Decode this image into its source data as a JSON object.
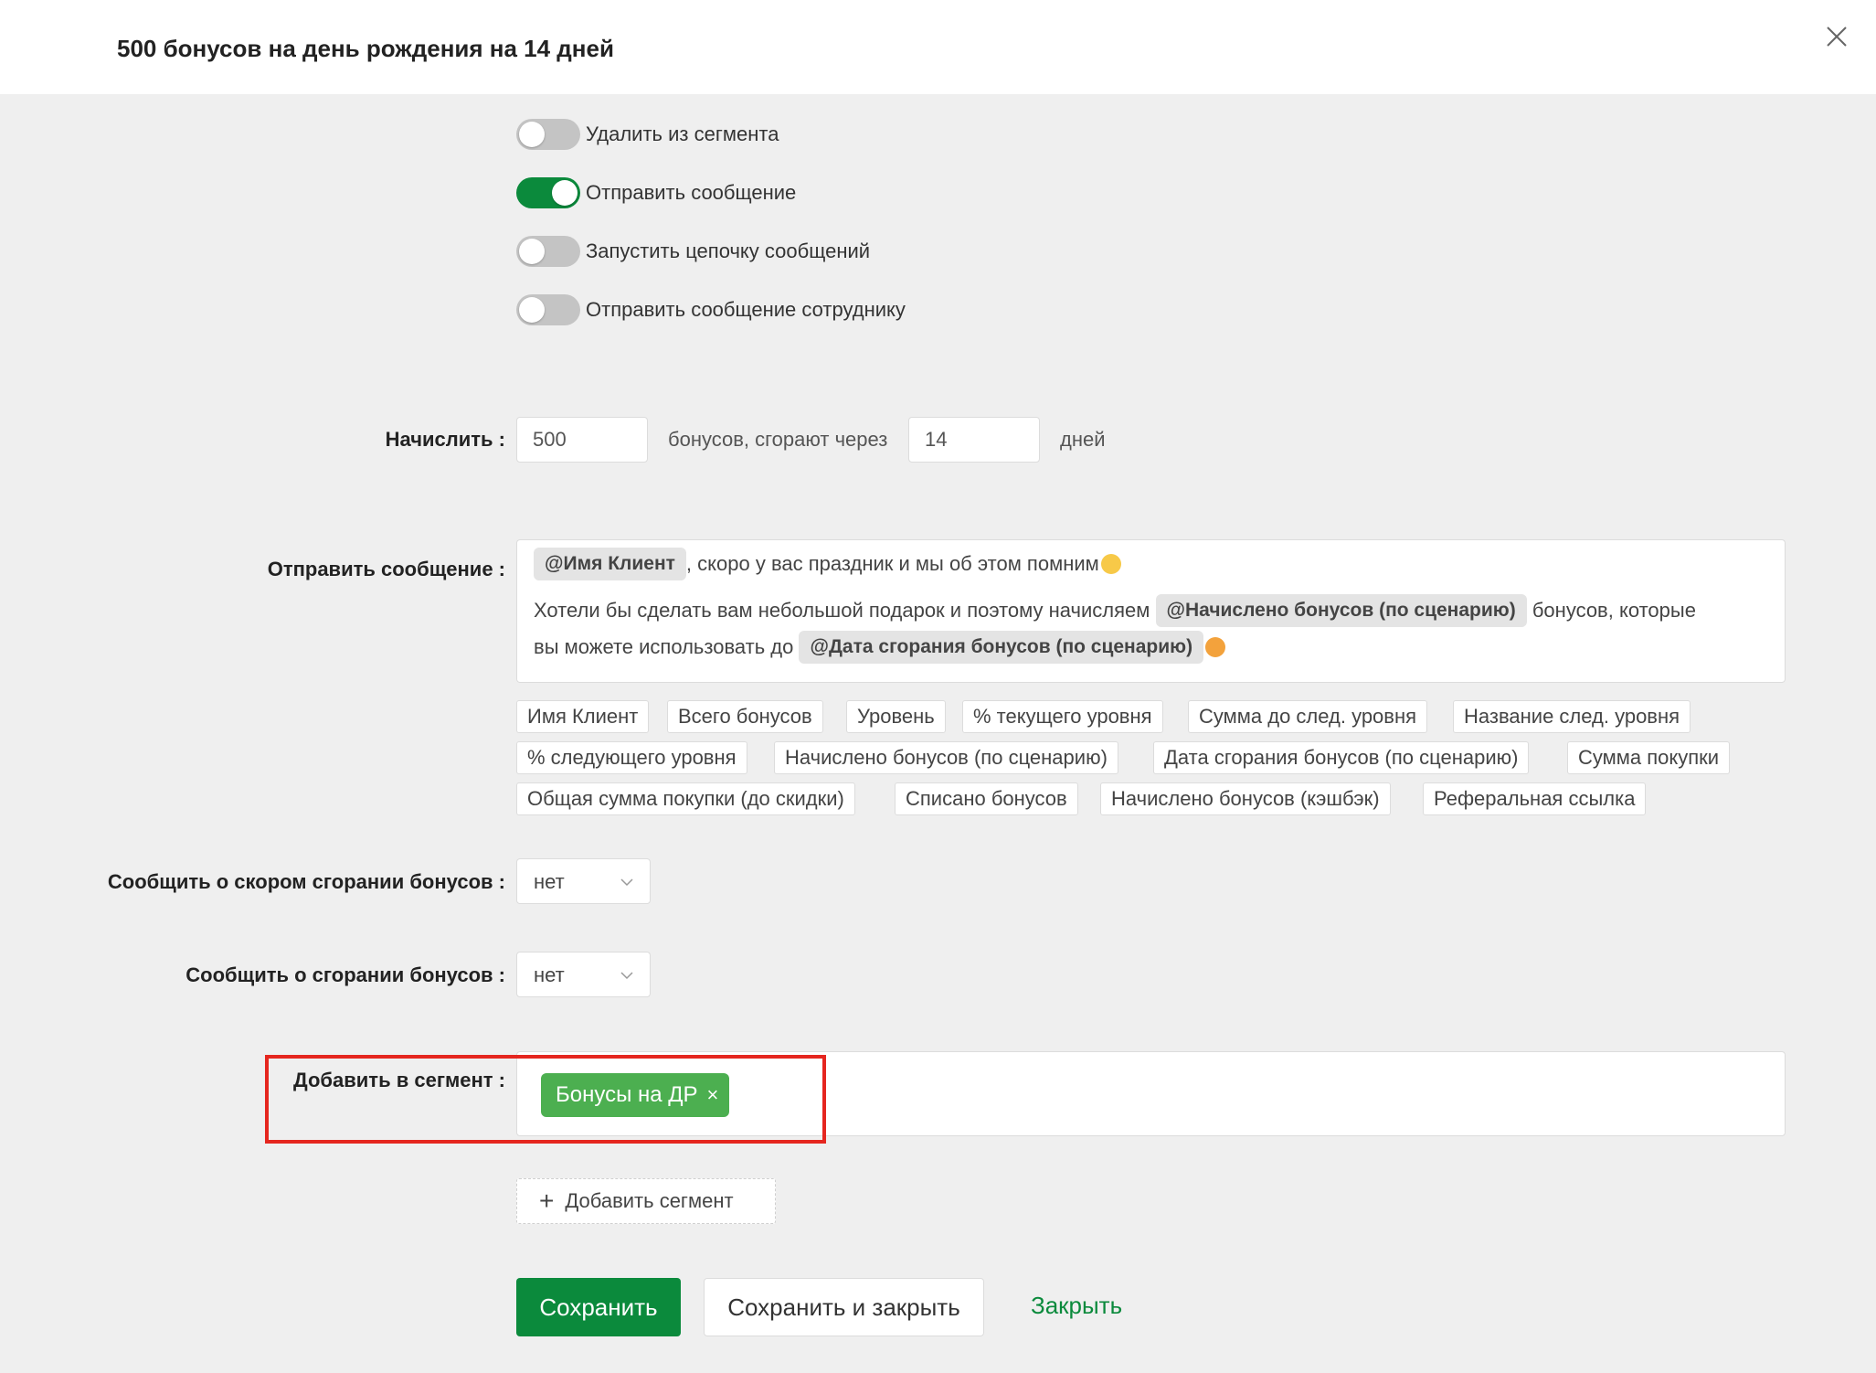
{
  "modal": {
    "title": "500 бонусов на день рождения на 14 дней",
    "close_icon": "close-icon"
  },
  "toggles": [
    {
      "label": "Удалить из сегмента",
      "on": false
    },
    {
      "label": "Отправить сообщение",
      "on": true
    },
    {
      "label": "Запустить цепочку сообщений",
      "on": false
    },
    {
      "label": "Отправить сообщение сотруднику",
      "on": false
    }
  ],
  "accrue": {
    "label": "Начислить :",
    "amount": "500",
    "middle_text": "бонусов, сгорают через",
    "days": "14",
    "suffix": "дней"
  },
  "message": {
    "label": "Отправить сообщение :",
    "line1_chip": "@Имя Клиент",
    "line1_text": ", скоро у вас праздник и мы об этом помним",
    "line2_text": "Хотели бы сделать вам небольшой подарок и поэтому начисляем ",
    "line2_chip": "@Начислено бонусов (по сценарию)",
    "line2_text_end": " бонусов, которые",
    "line3_text": "вы можете использовать до ",
    "line3_chip": "@Дата сгорания бонусов (по сценарию)",
    "variables": [
      "Имя Клиент",
      "Всего бонусов",
      "Уровень",
      "% текущего уровня",
      "Сумма до след. уровня",
      "Название след. уровня",
      "% следующего уровня",
      "Начислено бонусов (по сценарию)",
      "Дата сгорания бонусов (по сценарию)",
      "Сумма покупки",
      "Общая сумма покупки (до скидки)",
      "Списано бонусов",
      "Начислено бонусов (кэшбэк)",
      "Реферальная ссылка"
    ]
  },
  "notify_soon": {
    "label": "Сообщить о скором сгорании бонусов :",
    "value": "нет"
  },
  "notify_burn": {
    "label": "Сообщить о сгорании бонусов :",
    "value": "нет"
  },
  "segment": {
    "label": "Добавить в сегмент :",
    "chip": "Бонусы на ДР",
    "remove": "×",
    "add_button": "Добавить сегмент"
  },
  "actions": {
    "save": "Сохранить",
    "save_close": "Сохранить и закрыть",
    "close": "Закрыть"
  },
  "colors": {
    "accent": "#0b8a3c",
    "segment_chip": "#4caf50",
    "highlight": "#e5261f",
    "background": "#efefef"
  }
}
